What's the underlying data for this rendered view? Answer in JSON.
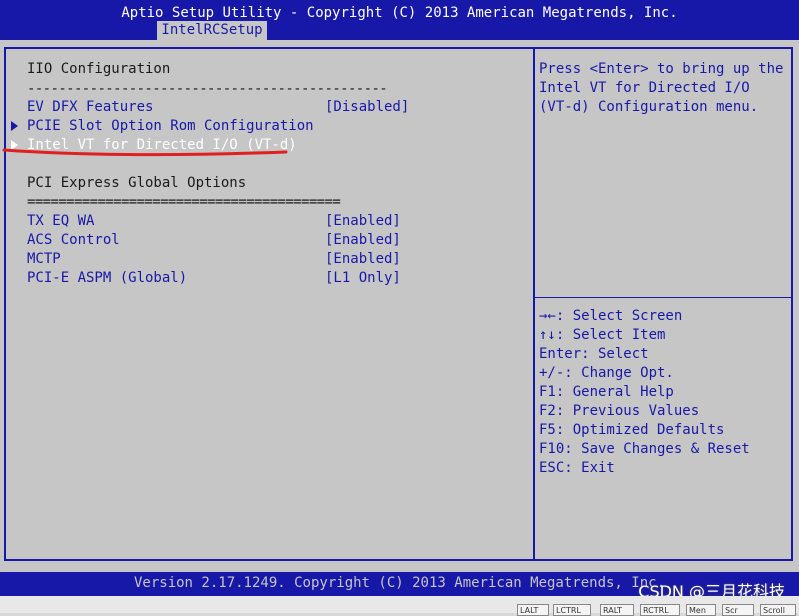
{
  "header": {
    "title": "Aptio Setup Utility - Copyright (C) 2013 American Megatrends, Inc.",
    "tab": "IntelRCSetup"
  },
  "left": {
    "section1_title": "IIO Configuration",
    "section1_sep": "----------------------------------------------",
    "items1": [
      {
        "label": "EV DFX Features",
        "value": "[Disabled]"
      },
      {
        "label": "PCIE Slot Option Rom Configuration"
      },
      {
        "label": "Intel VT for Directed I/O (VT-d)"
      }
    ],
    "section2_title": "PCI Express Global Options",
    "section2_sep": "========================================",
    "items2": [
      {
        "label": "TX EQ WA",
        "value": "[Enabled]"
      },
      {
        "label": "ACS Control",
        "value": "[Enabled]"
      },
      {
        "label": "MCTP",
        "value": "[Enabled]"
      },
      {
        "label": "PCI-E ASPM (Global)",
        "value": "[L1 Only]"
      }
    ]
  },
  "help": {
    "lines": [
      "Press <Enter> to bring up the",
      "Intel VT for Directed I/O",
      "(VT-d) Configuration menu."
    ]
  },
  "keys": [
    "→←: Select Screen",
    "↑↓: Select Item",
    "Enter: Select",
    "+/-: Change Opt.",
    "F1: General Help",
    "F2: Previous Values",
    "F5: Optimized Defaults",
    "F10: Save Changes & Reset",
    "ESC: Exit"
  ],
  "footer": {
    "version": "Version 2.17.1249. Copyright (C) 2013 American Megatrends, Inc.",
    "watermark": "CSDN @三月花科技"
  },
  "taskbar": [
    "LALT",
    "LCTRL",
    "RALT",
    "RCTRL",
    "Men",
    "Scr",
    "Scroll"
  ],
  "colors": {
    "bios_blue": "#1818a8",
    "bios_gray": "#c6c6c6",
    "highlight": "#ffffff",
    "annotation_red": "#e02020"
  }
}
